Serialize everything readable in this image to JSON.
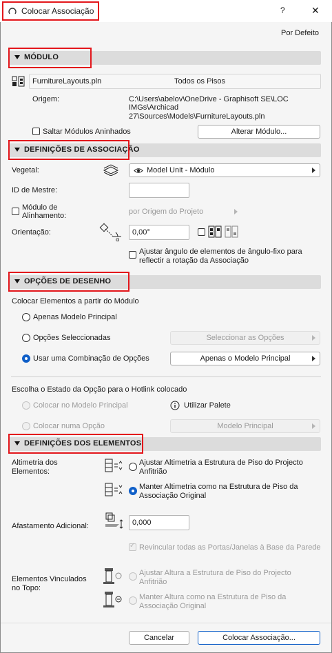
{
  "window": {
    "title": "Colocar Associação",
    "help": "?",
    "close": "✕"
  },
  "defaults_link": "Por Defeito",
  "modulo": {
    "header": "MÓDULO",
    "file_name": "FurnitureLayouts.pln",
    "floors": "Todos os Pisos",
    "origin_label": "Origem:",
    "origin_line1": "C:\\Users\\abelov\\OneDrive - Graphisoft SE\\LOC",
    "origin_line2": "IMGs\\Archicad",
    "origin_line3": "27\\Sources\\Models\\FurnitureLayouts.pln",
    "skip_nested": "Saltar Módulos Aninhados",
    "change_module": "Alterar Módulo..."
  },
  "assoc": {
    "header": "DEFINIÇÕES DE ASSOCIAÇÃO",
    "vegetal_label": "Vegetal:",
    "vegetal_value": "Model Unit - Módulo",
    "master_id_label": "ID de Mestre:",
    "master_id_value": "",
    "align_label_1": "Módulo de",
    "align_label_2": "Alinhamento:",
    "align_value": "por Origem do Projeto",
    "orient_label": "Orientação:",
    "orient_value": "0,00°",
    "adjust_1": "Ajustar ângulo de elementos de ângulo-fixo para",
    "adjust_2": "reflectir a rotação da Associação"
  },
  "draw": {
    "header": "OPÇÕES DE DESENHO",
    "place_from": "Colocar Elementos a partir do Módulo",
    "opt_main": "Apenas Modelo Principal",
    "opt_selected": "Opções Seleccionadas",
    "select_options_btn": "Seleccionar as Opções",
    "opt_combo": "Usar uma Combinação de Opções",
    "combo_value": "Apenas o Modelo Principal",
    "choose_state": "Escolha o Estado da Opção para o Hotlink colocado",
    "place_main": "Colocar no Modelo Principal",
    "use_palette": "Utilizar Palete",
    "place_option": "Colocar numa Opção",
    "option_value": "Modelo Principal"
  },
  "elements": {
    "header": "DEFINIÇÕES DOS ELEMENTOS",
    "alt_label_1": "Altimetria dos",
    "alt_label_2": "Elementos:",
    "alt_adjust_1": "Ajustar Altimetria a Estrutura de Piso do Projecto",
    "alt_adjust_2": "Anfitrião",
    "alt_keep_1": "Manter Altimetria como na Estrutura de Piso da",
    "alt_keep_2": "Associação Original",
    "offset_label": "Afastamento Adicional:",
    "offset_value": "0,000",
    "relink": "Revincular todas as Portas/Janelas à Base da Parede",
    "top_label_1": "Elementos Vinculados",
    "top_label_2": "no Topo:",
    "top_adjust_1": "Ajustar Altura a Estrutura de Piso do Projecto",
    "top_adjust_2": "Anfitrião",
    "top_keep_1": "Manter Altura como na Estrutura de Piso da",
    "top_keep_2": "Associação Original"
  },
  "footer": {
    "cancel": "Cancelar",
    "place": "Colocar Associação..."
  },
  "colors": {
    "highlight": "#e3161b",
    "accent": "#0f5fc8"
  }
}
